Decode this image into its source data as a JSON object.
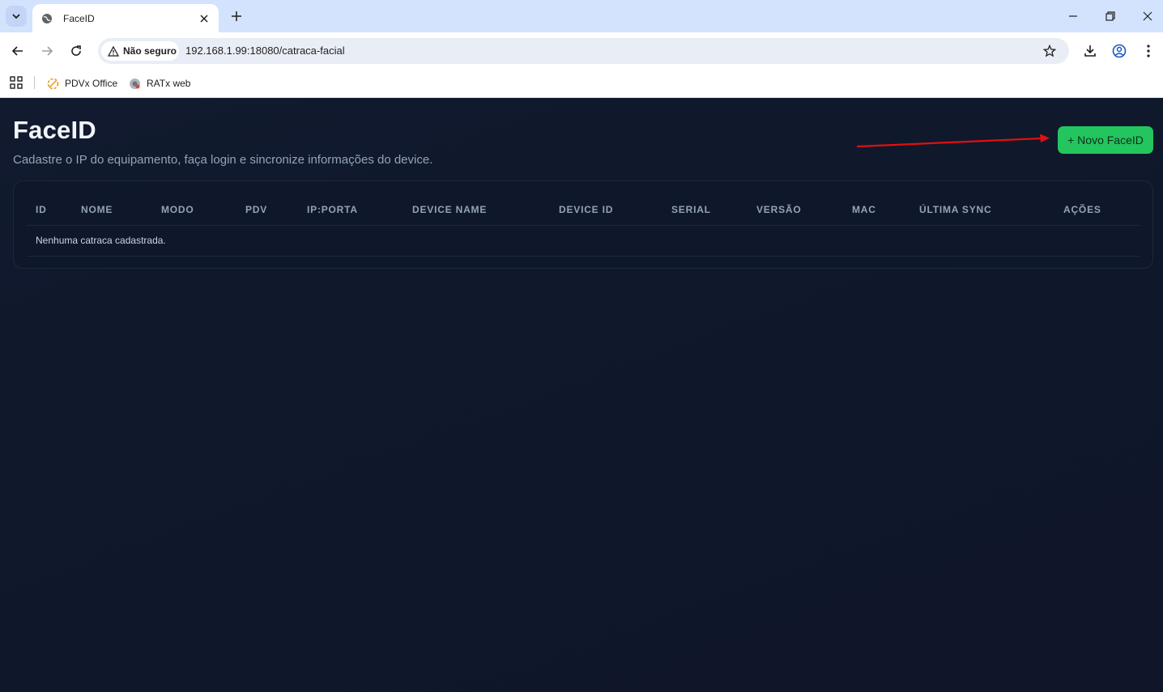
{
  "browser": {
    "tab_title": "FaceID",
    "security_label": "Não seguro",
    "url": "192.168.1.99:18080/catraca-facial",
    "bookmarks": [
      {
        "label": "PDVx Office",
        "icon": "pdvx-icon"
      },
      {
        "label": "RATx web",
        "icon": "ratx-icon"
      }
    ]
  },
  "page": {
    "title": "FaceID",
    "subtitle": "Cadastre o IP do equipamento, faça login e sincronize informações do device.",
    "new_button_label": "+ Novo FaceID"
  },
  "table": {
    "columns": [
      "ID",
      "NOME",
      "MODO",
      "PDV",
      "IP:PORTA",
      "DEVICE NAME",
      "DEVICE ID",
      "SERIAL",
      "VERSÃO",
      "MAC",
      "ÚLTIMA SYNC",
      "AÇÕES"
    ],
    "empty_message": "Nenhuma catraca cadastrada."
  },
  "colors": {
    "background": "#0f172a",
    "accent": "#22c55e",
    "annotation_arrow": "#e01010"
  }
}
